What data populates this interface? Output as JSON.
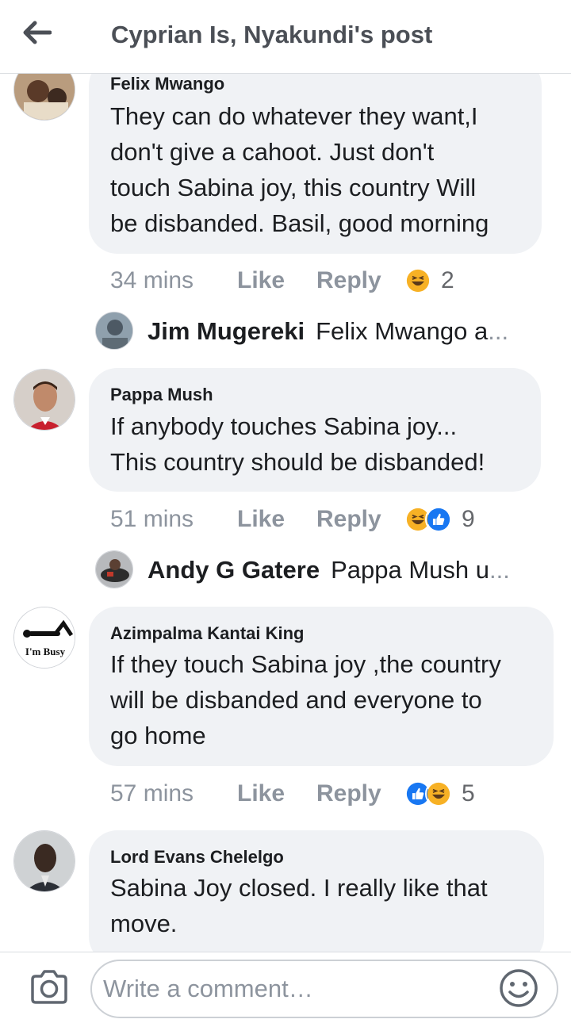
{
  "header": {
    "title": "Cyprian Is, Nyakundi's post",
    "back_icon": "arrow-left-icon"
  },
  "comments": [
    {
      "author": "Felix Mwango",
      "lines": [
        "They can do whatever they want,I",
        "don't give a cahoot. Just don't",
        "touch Sabina joy, this country Will",
        "be disbanded. Basil, good morning"
      ],
      "time": "34 mins",
      "like": "Like",
      "reply": "Reply",
      "reactions": [
        "haha"
      ],
      "reaction_count": "2",
      "reply_preview": {
        "name": "Jim Mugereki",
        "text": "Felix Mwango a",
        "ellipsis": "..."
      }
    },
    {
      "author": "Pappa Mush",
      "lines": [
        "If anybody touches Sabina joy...",
        "This country should be disbanded!"
      ],
      "time": "51 mins",
      "like": "Like",
      "reply": "Reply",
      "reactions": [
        "haha",
        "like"
      ],
      "reaction_count": "9",
      "reply_preview": {
        "name": "Andy G Gatere",
        "text": "Pappa Mush u",
        "ellipsis": "..."
      }
    },
    {
      "author": "Azimpalma Kantai King",
      "avatar_text": "I'm Busy",
      "lines": [
        "If they touch Sabina joy ,the country",
        "will be disbanded and everyone to",
        "go home"
      ],
      "time": "57 mins",
      "like": "Like",
      "reply": "Reply",
      "reactions": [
        "like",
        "haha"
      ],
      "reaction_count": "5"
    },
    {
      "author": "Lord Evans Chelelgo",
      "lines": [
        "Sabina Joy  closed. I really like that",
        "move."
      ]
    }
  ],
  "composer": {
    "placeholder": "Write a comment…"
  },
  "colors": {
    "bubble": "#f0f2f5",
    "meta": "#8d949e",
    "like_blue": "#1877f2",
    "haha_yellow": "#f7b125"
  }
}
